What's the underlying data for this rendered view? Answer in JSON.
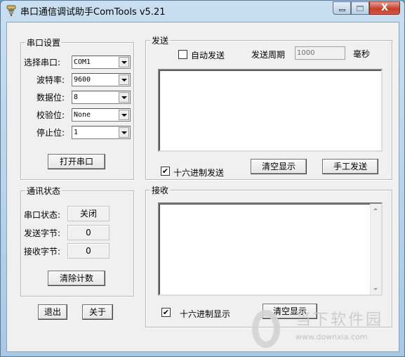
{
  "window": {
    "title": "串口通信调试助手ComTools v5.21",
    "controls": {
      "minimize": "minimize",
      "maximize": "maximize",
      "close": "X"
    }
  },
  "serial_settings": {
    "legend": "串口设置",
    "fields": [
      {
        "label": "选择串口:",
        "value": "COM1"
      },
      {
        "label": "波特率:",
        "value": "9600"
      },
      {
        "label": "数据位:",
        "value": "8"
      },
      {
        "label": "校验位:",
        "value": "None"
      },
      {
        "label": "停止位:",
        "value": "1"
      }
    ],
    "open_button": "打开串口"
  },
  "status": {
    "legend": "通讯状态",
    "rows": [
      {
        "label": "串口状态:",
        "value": "关闭"
      },
      {
        "label": "发送字节:",
        "value": "0"
      },
      {
        "label": "接收字节:",
        "value": "0"
      }
    ],
    "clear_count_button": "清除计数"
  },
  "bottom_buttons": {
    "exit": "退出",
    "about": "关于"
  },
  "send": {
    "legend": "发送",
    "auto_send_label": "自动发送",
    "auto_send_checked": false,
    "period_label": "发送周期",
    "period_value": "1000",
    "period_unit": "毫秒",
    "text": "",
    "hex_send_label": "十六进制发送",
    "hex_send_checked": true,
    "clear_button": "清空显示",
    "manual_send_button": "手工发送"
  },
  "receive": {
    "legend": "接收",
    "text": "",
    "hex_display_label": "十六进制显示",
    "hex_display_checked": true,
    "clear_button": "清空显示"
  },
  "watermark": {
    "name": "当下软件园",
    "url": "www.downxia.com"
  }
}
